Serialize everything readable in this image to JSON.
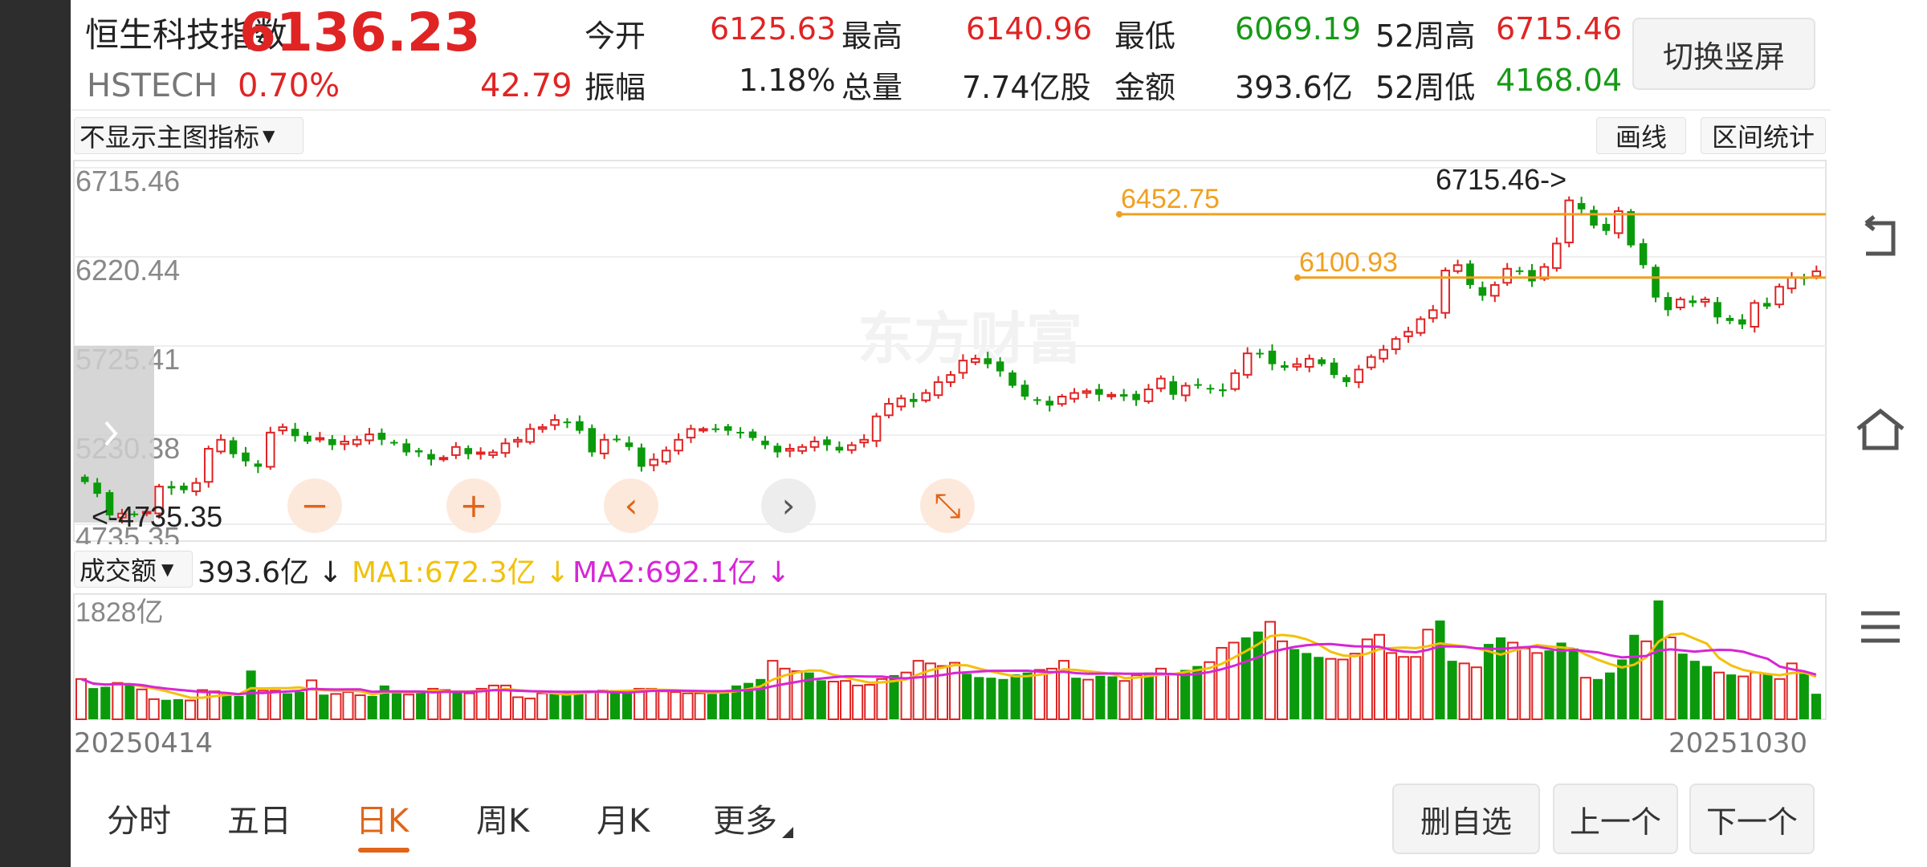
{
  "header": {
    "name": "恒生科技指数",
    "code": "HSTECH",
    "price": "6136.23",
    "change_pct": "0.70%",
    "change": "42.79",
    "open_label": "今开",
    "open": "6125.63",
    "high_label": "最高",
    "high": "6140.96",
    "low_label": "最低",
    "low": "6069.19",
    "w52h_label": "52周高",
    "w52h": "6715.46",
    "amp_label": "振幅",
    "amp": "1.18%",
    "vol_label": "总量",
    "vol": "7.74亿股",
    "amt_label": "金额",
    "amt": "393.6亿",
    "w52l_label": "52周低",
    "w52l": "4168.04",
    "switch_label": "切换竖屏"
  },
  "chart_toolbar": {
    "indicator_select": "不显示主图指标",
    "draw_btn": "画线",
    "range_btn": "区间统计"
  },
  "chart_data": {
    "type": "candlestick",
    "y_ticks": [
      "6715.46",
      "6220.44",
      "5725.41",
      "5230.38",
      "4735.35"
    ],
    "ylim": [
      4735.35,
      6715.46
    ],
    "max_marker": "6715.46->",
    "min_marker": "<-4735.35",
    "hlines": [
      {
        "label": "6452.75",
        "value": 6452.75
      },
      {
        "label": "6100.93",
        "value": 6100.93
      }
    ],
    "watermark": "东方财富",
    "x_start": "20250414",
    "x_end": "20251030",
    "colors": {
      "up": "#e02424",
      "down": "#0b9a0b",
      "hline": "#f0a020",
      "ma1": "#f2c10a",
      "ma2": "#d626d6"
    },
    "closes": [
      4965,
      4900,
      4780,
      4790,
      4785,
      4800,
      4940,
      4930,
      4920,
      4960,
      5150,
      5200,
      5120,
      5080,
      5050,
      5240,
      5270,
      5220,
      5190,
      5210,
      5170,
      5190,
      5200,
      5230,
      5200,
      5180,
      5130,
      5130,
      5090,
      5100,
      5160,
      5120,
      5130,
      5130,
      5180,
      5200,
      5260,
      5270,
      5310,
      5300,
      5250,
      5130,
      5200,
      5200,
      5160,
      5050,
      5090,
      5140,
      5200,
      5260,
      5260,
      5260,
      5250,
      5240,
      5210,
      5170,
      5130,
      5150,
      5160,
      5190,
      5170,
      5140,
      5170,
      5200,
      5330,
      5400,
      5430,
      5410,
      5460,
      5520,
      5560,
      5640,
      5650,
      5620,
      5580,
      5500,
      5440,
      5420,
      5390,
      5440,
      5460,
      5470,
      5450,
      5450,
      5440,
      5420,
      5480,
      5540,
      5450,
      5500,
      5500,
      5480,
      5470,
      5570,
      5680,
      5680,
      5620,
      5600,
      5620,
      5650,
      5620,
      5560,
      5520,
      5590,
      5660,
      5700,
      5760,
      5800,
      5870,
      5920,
      6140,
      6170,
      6060,
      6000,
      6060,
      6150,
      6140,
      6080,
      6160,
      6290,
      6530,
      6480,
      6390,
      6360,
      6470,
      6280,
      6170,
      5990,
      5920,
      5980,
      5960,
      5980,
      5880,
      5860,
      5840,
      5960,
      5940,
      6050,
      6100,
      6093,
      6136
    ],
    "volume": {
      "label_select": "成交额",
      "current": "393.6亿 ↓",
      "ma1_label": "MA1:672.3亿 ↓",
      "ma2_label": "MA2:692.1亿 ↓",
      "max_label": "1828亿",
      "values": [
        620,
        480,
        500,
        560,
        540,
        460,
        310,
        300,
        310,
        290,
        450,
        430,
        400,
        360,
        750,
        440,
        440,
        400,
        420,
        600,
        380,
        390,
        420,
        370,
        360,
        520,
        430,
        380,
        420,
        470,
        450,
        410,
        400,
        470,
        520,
        520,
        340,
        320,
        400,
        420,
        420,
        420,
        430,
        440,
        450,
        450,
        470,
        470,
        430,
        420,
        400,
        400,
        390,
        450,
        520,
        560,
        620,
        900,
        780,
        740,
        720,
        600,
        580,
        590,
        520,
        530,
        620,
        680,
        720,
        900,
        860,
        820,
        870,
        700,
        650,
        640,
        620,
        690,
        720,
        760,
        780,
        900,
        640,
        610,
        670,
        660,
        590,
        680,
        720,
        780,
        700,
        760,
        820,
        880,
        1100,
        1180,
        1260,
        1350,
        1500,
        1200,
        1080,
        1020,
        960,
        930,
        920,
        1010,
        1230,
        1300,
        1020,
        960,
        960,
        1380,
        1520,
        900,
        860,
        800,
        1160,
        1260,
        1180,
        1090,
        1020,
        1060,
        1180,
        1090,
        640,
        620,
        720,
        920,
        1300,
        1200,
        1828,
        1260,
        1010,
        900,
        820,
        720,
        690,
        660,
        720,
        700,
        620,
        860,
        700,
        393
      ]
    }
  },
  "tabs": [
    "分时",
    "五日",
    "日K",
    "周K",
    "月K",
    "更多"
  ],
  "active_tab": "日K",
  "actions": {
    "remove": "删自选",
    "prev": "上一个",
    "next": "下一个"
  }
}
